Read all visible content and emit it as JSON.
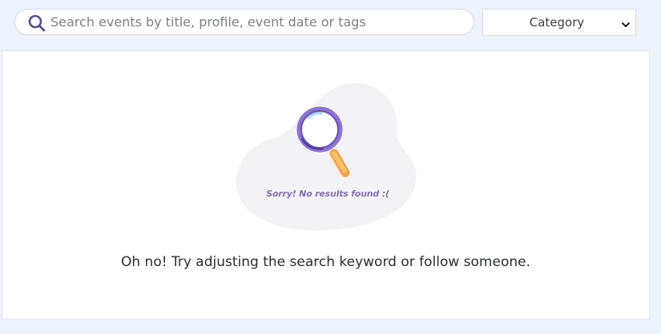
{
  "search": {
    "placeholder": "Search events by title, profile, event date or tags",
    "value": "",
    "icon": "search-icon",
    "icon_color": "#5a4d8f"
  },
  "category": {
    "selected": "Category",
    "icon": "chevron-down-icon"
  },
  "empty_state": {
    "illustration_text": "Sorry! No results found :(",
    "message": "Oh no! Try adjusting the search keyword or follow someone.",
    "illustration_icon": "magnifier-icon",
    "colors": {
      "blob": "#f3f3f6",
      "lens_ring": "#7b62c4",
      "handle": "#f7b35a",
      "text": "#8472b3"
    }
  },
  "colors": {
    "background": "#eef2fb",
    "panel": "#ffffff"
  }
}
